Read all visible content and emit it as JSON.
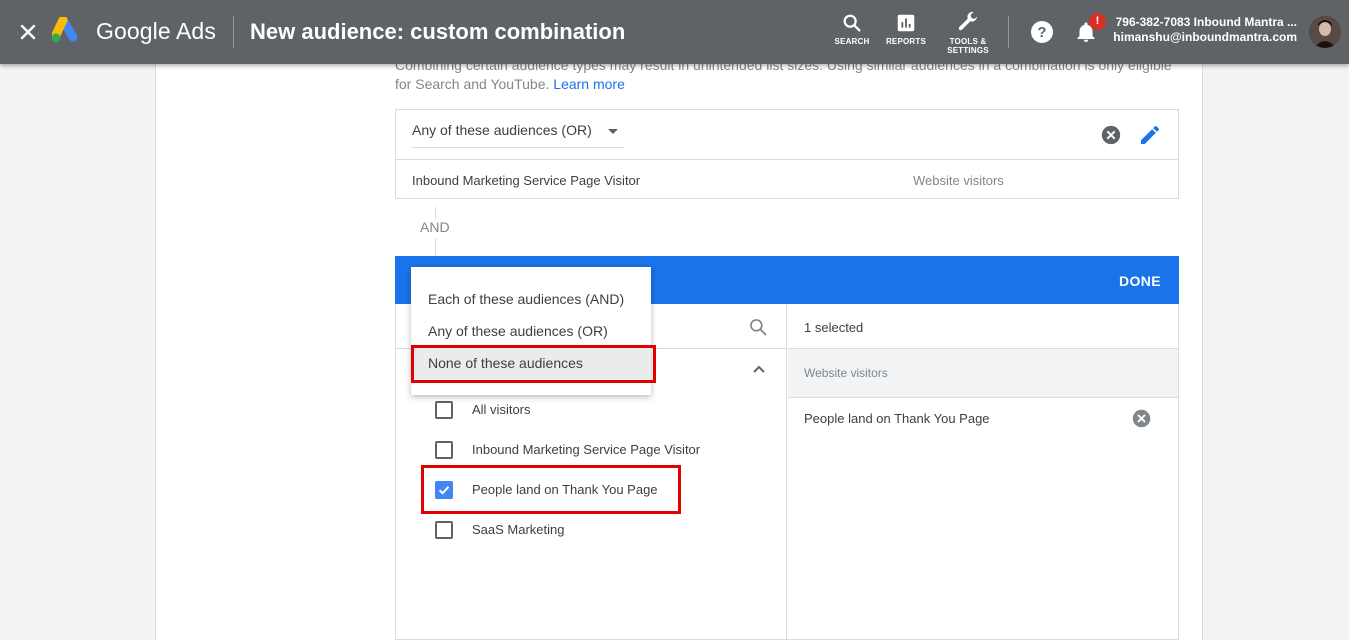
{
  "header": {
    "brand": "Google Ads",
    "title": "New audience: custom combination",
    "tools": [
      {
        "label": "SEARCH",
        "icon": "search-icon"
      },
      {
        "label": "REPORTS",
        "icon": "reports-icon"
      },
      {
        "label": "TOOLS &",
        "label2": "SETTINGS",
        "icon": "wrench-icon"
      }
    ],
    "notification_badge": "!",
    "account_id": "796-382-7083 Inbound Mantra ...",
    "account_email": "himanshu@inboundmantra.com"
  },
  "note": {
    "text": "Combining certain audience types may result in unintended list sizes. Using similar audiences in a combination is only eligible for Search and YouTube.",
    "link": "Learn more"
  },
  "group1": {
    "operator": "Any of these audiences (OR)",
    "audience_name": "Inbound Marketing Service Page Visitor",
    "audience_type": "Website visitors"
  },
  "connector": "AND",
  "editor": {
    "done_label": "DONE",
    "menu_options": [
      "Each of these audiences (AND)",
      "Any of these audiences (OR)",
      "None of these audiences"
    ],
    "highlighted_option": "None of these audiences",
    "audiences": [
      {
        "label": "All visitors",
        "checked": false
      },
      {
        "label": "Inbound Marketing Service Page Visitor",
        "checked": false
      },
      {
        "label": "People land on Thank You Page",
        "checked": true
      },
      {
        "label": "SaaS Marketing",
        "checked": false
      }
    ],
    "selected_count": "1 selected",
    "selected_category": "Website visitors",
    "selected_items": [
      "People land on Thank You Page"
    ]
  },
  "colors": {
    "header_bg": "#5f6368",
    "accent_blue": "#1a73e8",
    "checkbox_blue": "#4285f4",
    "highlight_red": "#e00000"
  }
}
